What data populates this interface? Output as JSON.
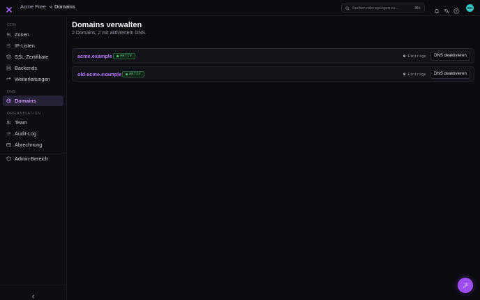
{
  "header": {
    "org_name": "Acme Free",
    "breadcrumb_sep": "/",
    "breadcrumb_current": "Domains",
    "search_placeholder": "Suchen oder springen zu...",
    "search_shortcut": "⌘K",
    "avatar_initials": "DA"
  },
  "sidebar": {
    "section_cdn": "CDN",
    "cdn_items": [
      {
        "label": "Zonen",
        "icon": "zones-icon"
      },
      {
        "label": "IP-Listen",
        "icon": "list-icon"
      },
      {
        "label": "SSL-Zertifikate",
        "icon": "shield-check-icon"
      },
      {
        "label": "Backends",
        "icon": "server-icon"
      },
      {
        "label": "Weiterleitungen",
        "icon": "redirect-icon"
      }
    ],
    "section_dns": "DNS",
    "dns_items": [
      {
        "label": "Domains",
        "icon": "globe-icon",
        "active": true
      }
    ],
    "section_org": "ORGANISATION",
    "org_items": [
      {
        "label": "Team",
        "icon": "users-icon"
      },
      {
        "label": "Audit-Log",
        "icon": "list-icon"
      },
      {
        "label": "Abrechnung",
        "icon": "credit-card-icon"
      }
    ],
    "admin_item": {
      "label": "Admin-Bereich",
      "icon": "shield-icon"
    }
  },
  "main": {
    "title": "Domains verwalten",
    "subtitle": "2 Domains, 2 mit aktiviertem DNS.",
    "domains": [
      {
        "name": "acme.example",
        "status": "AKTIV",
        "entries_count": "0",
        "entries_label": "Einträge",
        "action": "DNS deaktivieren"
      },
      {
        "name": "old-acme.example",
        "status": "AKTIV",
        "entries_count": "0",
        "entries_label": "Einträge",
        "action": "DNS deaktivieren"
      }
    ]
  },
  "colors": {
    "accent": "#9d4ef0",
    "active_link": "#b774f2",
    "status_green": "#4bd27e",
    "avatar": "#2cc4bc",
    "background": "#0b0b10"
  }
}
